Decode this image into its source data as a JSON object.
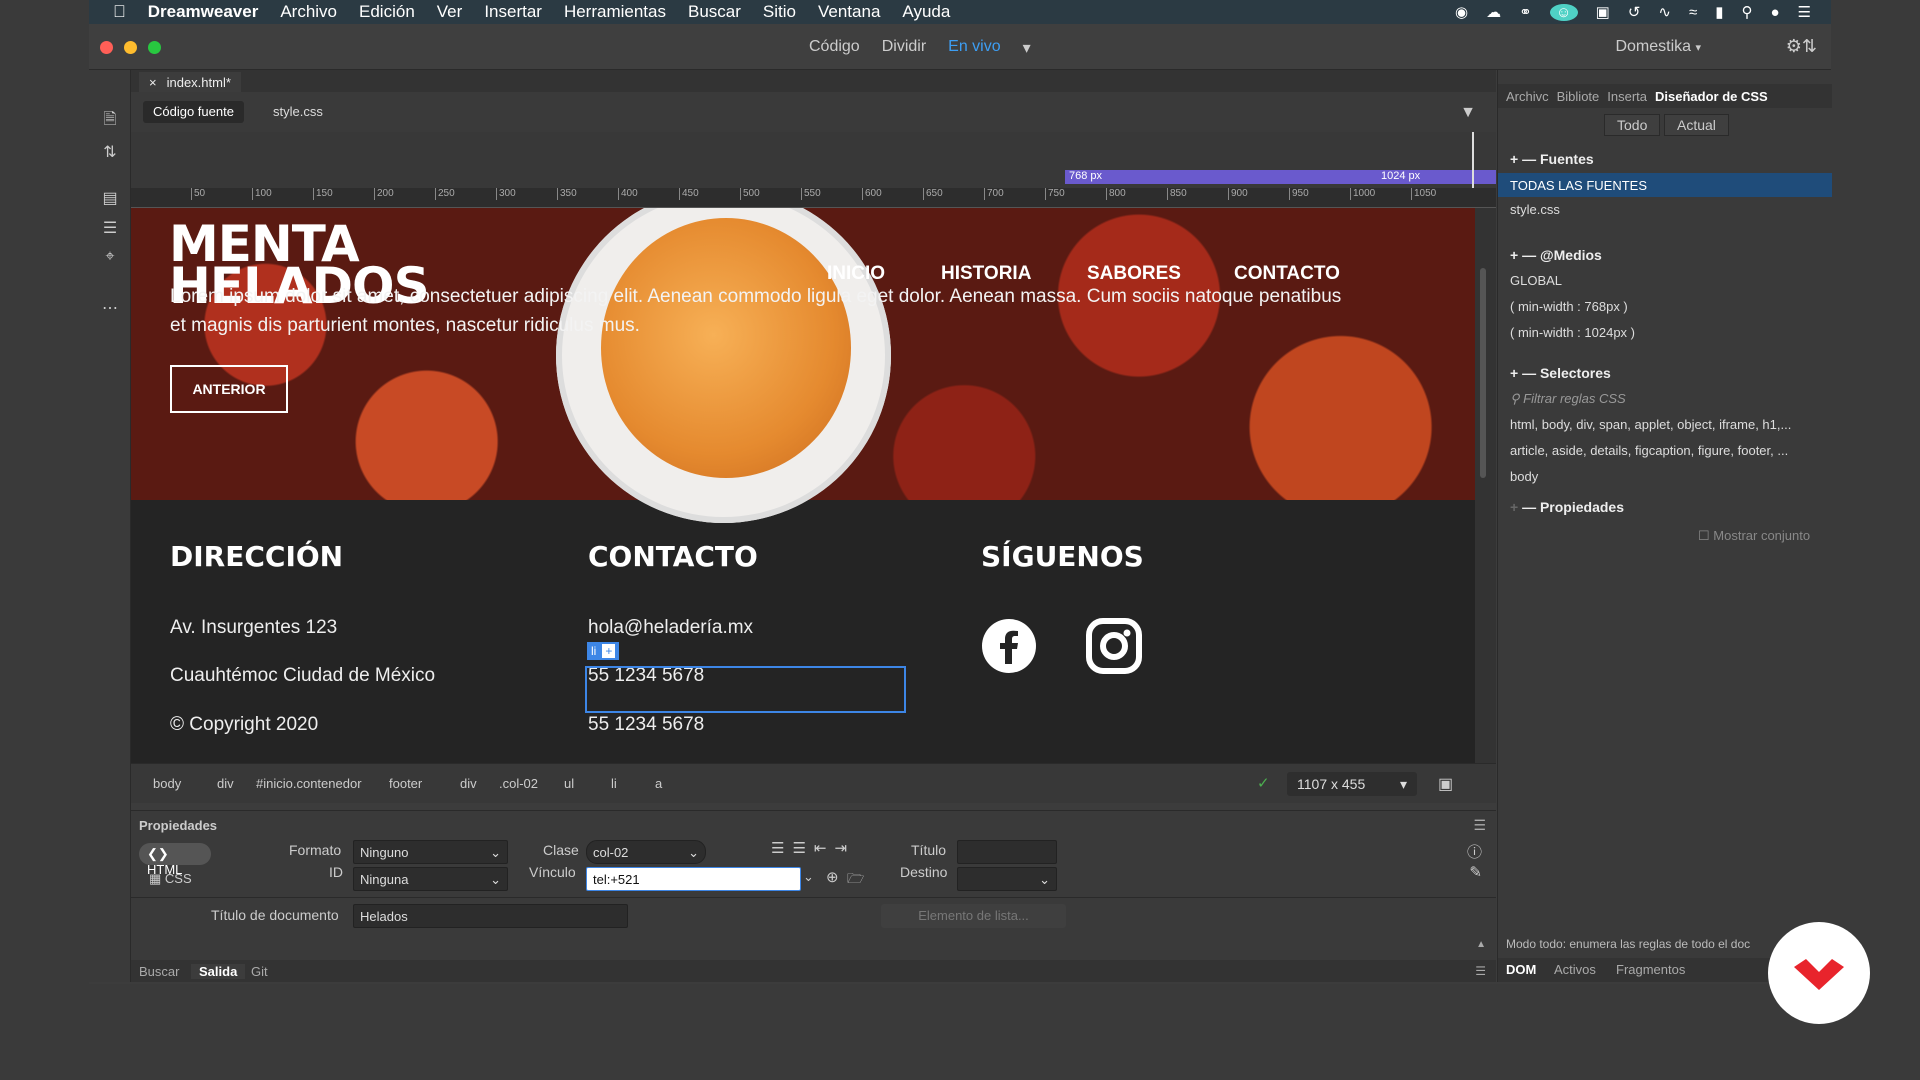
{
  "menubar": {
    "app": "Dreamweaver",
    "items": [
      "Archivo",
      "Edición",
      "Ver",
      "Insertar",
      "Herramientas",
      "Buscar",
      "Sitio",
      "Ventana",
      "Ayuda"
    ]
  },
  "toolbar": {
    "modes": [
      "Código",
      "Dividir",
      "En vivo"
    ],
    "workspace": "Domestika"
  },
  "tabs": {
    "file": "index.html*",
    "source": "Código fuente",
    "css": "style.css"
  },
  "mq": {
    "bp1": "768",
    "bp2": "1024",
    "unit": "px"
  },
  "ruler": [
    "50",
    "100",
    "150",
    "200",
    "250",
    "300",
    "350",
    "400",
    "450",
    "500",
    "550",
    "600",
    "650",
    "700",
    "750",
    "800",
    "850",
    "900",
    "950",
    "1000",
    "1050"
  ],
  "hero": {
    "logo_line1": "MENTA",
    "logo_line2": "HELADOS",
    "nav": [
      "INICIO",
      "HISTORIA",
      "SABORES",
      "CONTACTO"
    ],
    "lorem": "Lorem ipsum dolor sit amet, consectetuer adipiscing elit. Aenean commodo ligula eget dolor. Aenean massa. Cum sociis natoque penatibus et magnis dis parturient montes, nascetur ridiculus mus.",
    "button": "ANTERIOR"
  },
  "footer": {
    "col1": {
      "title": "DIRECCIÓN",
      "lines": [
        "Av. Insurgentes 123",
        "Cuauhtémoc Ciudad de México",
        "© Copyright 2020"
      ]
    },
    "col2": {
      "title": "CONTACTO",
      "lines": [
        "hola@heladería.mx",
        "55 1234 5678",
        "55 1234 5678"
      ]
    },
    "col3": {
      "title": "SÍGUENOS"
    },
    "tag": "li",
    "tag_add": "+"
  },
  "taglist": [
    "body",
    "div",
    "#inicio.contenedor",
    "footer",
    "div",
    ".col-02",
    "ul",
    "li",
    "a"
  ],
  "dimensions": "1107 x 455",
  "properties": {
    "title": "Propiedades",
    "html_tab": "HTML",
    "css_tab": "CSS",
    "formato_label": "Formato",
    "formato_value": "Ninguno",
    "id_label": "ID",
    "id_value": "Ninguna",
    "clase_label": "Clase",
    "clase_value": "col-02",
    "vinculo_label": "Vínculo",
    "vinculo_value": "tel:+521",
    "titulo_label": "Título",
    "destino_label": "Destino",
    "doc_title_label": "Título de documento",
    "doc_title_value": "Helados",
    "list_item_btn": "Elemento de lista..."
  },
  "bottom_tabs": [
    "Buscar",
    "Salida",
    "Git"
  ],
  "right_panel": {
    "tabs": [
      "Archivc",
      "Bibliote",
      "Inserta",
      "Diseñador de CSS"
    ],
    "buttons": [
      "Todo",
      "Actual"
    ],
    "fuentes": "Fuentes",
    "fuentes_all": "TODAS LAS FUENTES",
    "fuentes_file": "style.css",
    "medios": "@Medios",
    "medios_items": [
      "GLOBAL",
      "( min-width : 768px )",
      "( min-width : 1024px )"
    ],
    "selectores": "Selectores",
    "filter_placeholder": "Filtrar reglas CSS",
    "selector_items": [
      "html, body, div, span, applet, object, iframe, h1,...",
      "article, aside, details, figcaption, figure, footer, ...",
      "body"
    ],
    "propiedades": "Propiedades",
    "mostrar": "Mostrar conjunto",
    "status": "Modo todo: enumera las reglas de todo el doc",
    "bottom_tabs": [
      "DOM",
      "Activos",
      "Fragmentos"
    ]
  },
  "colors": {
    "accent": "#3d9ef3",
    "selection": "#3d86e6",
    "mq_bar": "#6a5acd",
    "brand": "#e8242c"
  }
}
